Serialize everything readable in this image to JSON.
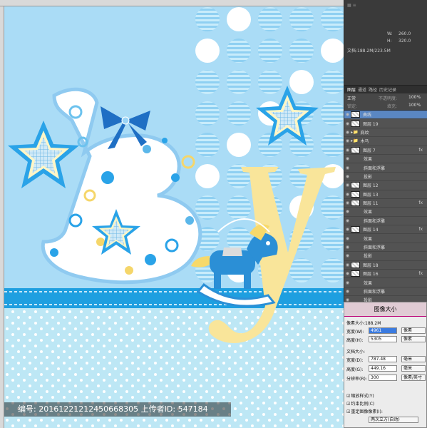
{
  "info_panel": {
    "w_label": "W:",
    "w_value": "260.0",
    "h_label": "H:",
    "h_value": "320.0",
    "doc_label": "文档:188.2M/223.5M"
  },
  "layers_panel": {
    "tabs": [
      "图层",
      "通道",
      "路径",
      "历史记录"
    ],
    "blend_mode": "正常",
    "opacity_label": "不透明度:",
    "opacity_value": "100%",
    "lock_label": "锁定:",
    "fill_label": "填充:",
    "fill_value": "100%",
    "layers": [
      {
        "name": "曲线",
        "type": "layer",
        "selected": true,
        "fx": ""
      },
      {
        "name": "图层 19",
        "type": "layer",
        "selected": false,
        "fx": ""
      },
      {
        "name": "底纹",
        "type": "group",
        "selected": false,
        "fx": ""
      },
      {
        "name": "木马",
        "type": "group",
        "selected": false,
        "fx": ""
      },
      {
        "name": "图层 7",
        "type": "layer",
        "selected": false,
        "fx": "fx"
      },
      {
        "name": "效果",
        "type": "effect",
        "selected": false,
        "fx": ""
      },
      {
        "name": "斜面和浮雕",
        "type": "effect",
        "selected": false,
        "fx": ""
      },
      {
        "name": "投影",
        "type": "effect",
        "selected": false,
        "fx": ""
      },
      {
        "name": "图层 12",
        "type": "layer",
        "selected": false,
        "fx": ""
      },
      {
        "name": "图层 13",
        "type": "layer",
        "selected": false,
        "fx": ""
      },
      {
        "name": "图层 11",
        "type": "layer",
        "selected": false,
        "fx": "fx"
      },
      {
        "name": "效果",
        "type": "effect",
        "selected": false,
        "fx": ""
      },
      {
        "name": "斜面和浮雕",
        "type": "effect",
        "selected": false,
        "fx": ""
      },
      {
        "name": "图层 14",
        "type": "layer",
        "selected": false,
        "fx": "fx"
      },
      {
        "name": "效果",
        "type": "effect",
        "selected": false,
        "fx": ""
      },
      {
        "name": "斜面和浮雕",
        "type": "effect",
        "selected": false,
        "fx": ""
      },
      {
        "name": "投影",
        "type": "effect",
        "selected": false,
        "fx": ""
      },
      {
        "name": "图层 18",
        "type": "layer",
        "selected": false,
        "fx": ""
      },
      {
        "name": "图层 16",
        "type": "layer",
        "selected": false,
        "fx": "fx"
      },
      {
        "name": "效果",
        "type": "effect",
        "selected": false,
        "fx": ""
      },
      {
        "name": "斜面和浮雕",
        "type": "effect",
        "selected": false,
        "fx": ""
      },
      {
        "name": "投影",
        "type": "effect",
        "selected": false,
        "fx": ""
      },
      {
        "name": "图层 15",
        "type": "layer",
        "selected": false,
        "fx": "fx"
      }
    ]
  },
  "image_size_dialog": {
    "title": "图像大小",
    "pixel_size_label": "像素大小:188.2M",
    "px_width_label": "宽度(W):",
    "px_width_value": "4961",
    "px_height_label": "高度(H):",
    "px_height_value": "5305",
    "px_unit": "像素",
    "doc_size_label": "文档大小:",
    "doc_width_label": "宽度(D):",
    "doc_width_value": "787.48",
    "doc_height_label": "高度(G):",
    "doc_height_value": "449.16",
    "doc_unit": "毫米",
    "res_label": "分辨率(R):",
    "res_value": "300",
    "res_unit": "像素/英寸",
    "scale_styles": "缩放样式(Y)",
    "constrain": "约束比例(C)",
    "resample": "重定图像像素(I):",
    "resample_method": "两次立方(自动)"
  },
  "watermark": {
    "text": "编号: 20161221212450668305 上传者ID: 547184"
  },
  "artwork": {
    "letters": [
      "B",
      "y"
    ],
    "colors": {
      "background": "#aadcf6",
      "circles": "#c2e8fa",
      "stripe_dark": "#1296d6",
      "dot_bg": "#bde7f5",
      "letter_b": "#ffffff",
      "letter_y": "#f9e59a",
      "star_blue": "#3aa6e3",
      "horse_blue": "#2b8fd6"
    }
  }
}
